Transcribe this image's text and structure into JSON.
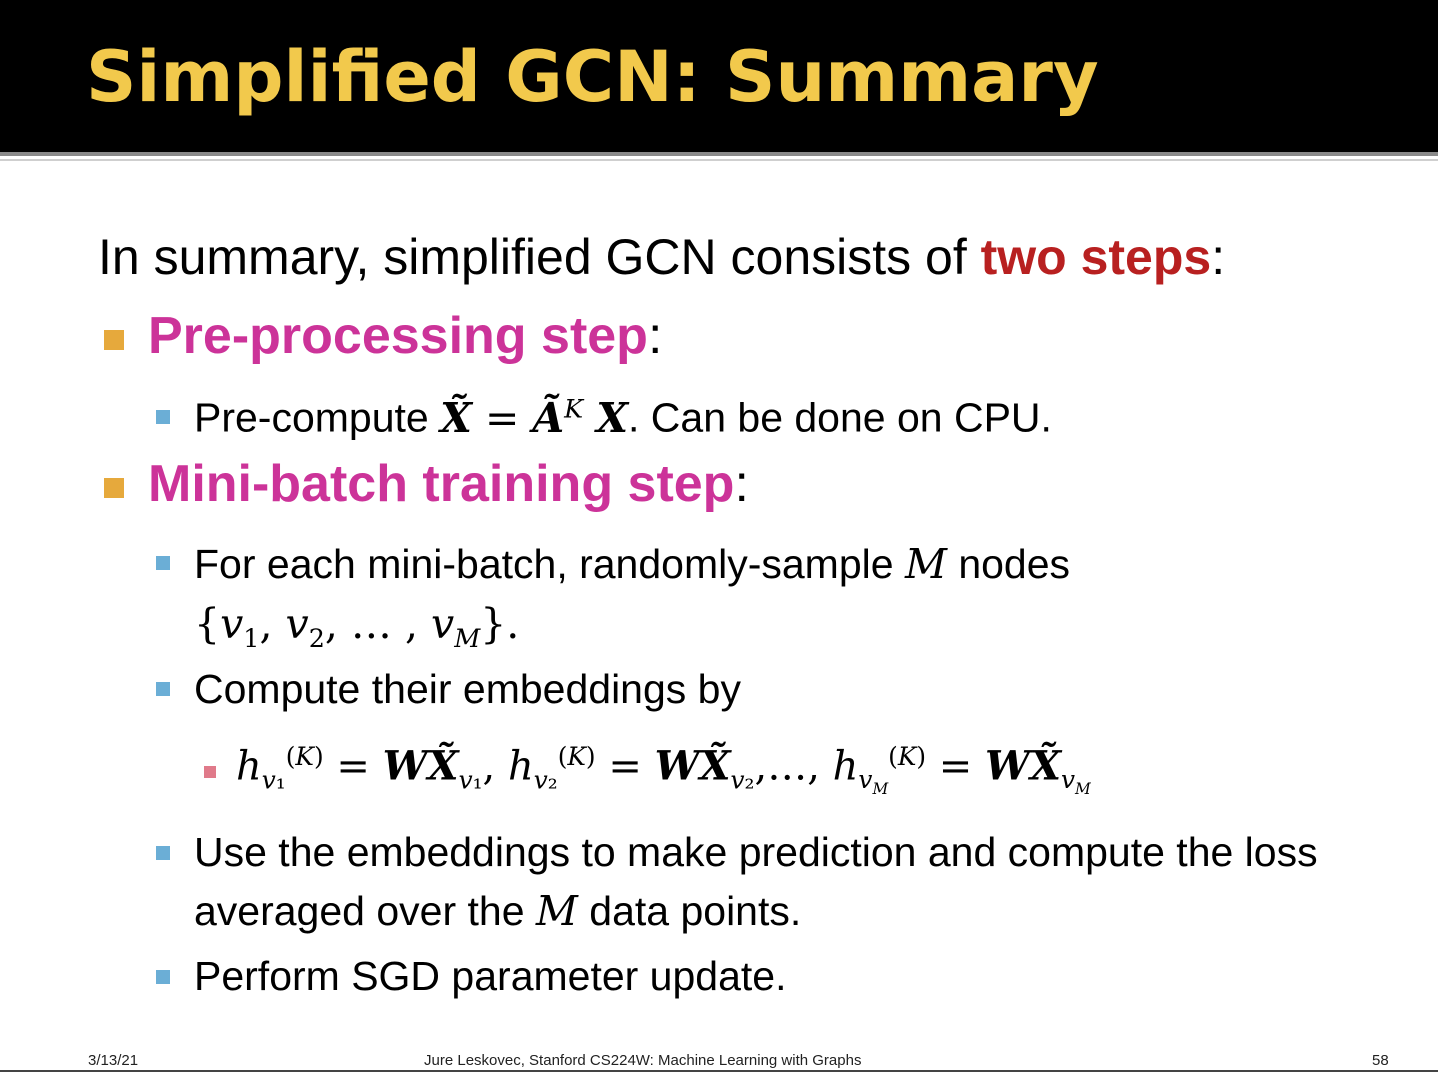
{
  "slide": {
    "title": "Simplified GCN: Summary",
    "lead_prefix": "In summary, simplified GCN consists of ",
    "lead_emph": "two steps",
    "lead_suffix": ":",
    "step1": {
      "label": "Pre-processing step",
      "suffix": ":",
      "bullet1_prefix": "Pre-compute ",
      "bullet1_suffix": ". Can be done on CPU."
    },
    "step2": {
      "label": "Mini-batch training step",
      "suffix": ":",
      "bullet1_line1_prefix": "For each mini-batch, randomly-sample ",
      "bullet1_line1_var": "M",
      "bullet1_line1_suffix": " nodes",
      "bullet2": "Compute their embeddings by",
      "bullet3_line1": "Use the embeddings to make prediction and compute the loss",
      "bullet3_line2_prefix": "averaged over the ",
      "bullet3_line2_var": "M",
      "bullet3_line2_suffix": " data points.",
      "bullet4": "Perform SGD parameter update."
    }
  },
  "footer": {
    "date": "3/13/21",
    "course": "Jure Leskovec, Stanford CS224W: Machine Learning with Graphs",
    "page": "58"
  },
  "colors": {
    "title": "#F2C94C",
    "emphasis_red": "#B82020",
    "emphasis_magenta": "#CC3399",
    "bullet_level1": "#E6A93C",
    "bullet_level2": "#6BAED6",
    "bullet_level3": "#E07A8A"
  }
}
